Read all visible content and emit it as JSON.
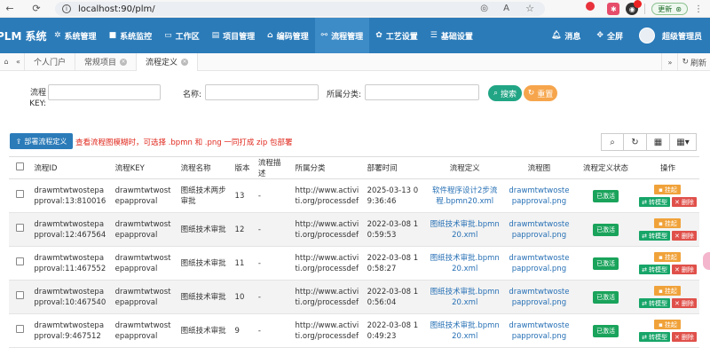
{
  "browser": {
    "url": "localhost:90/plm/",
    "update_label": "更新"
  },
  "app": {
    "brand": "PLM 系统",
    "menu": [
      {
        "label": "系统管理",
        "icon": "gear-icon"
      },
      {
        "label": "系统监控",
        "icon": "video-icon"
      },
      {
        "label": "工作区",
        "icon": "monitor-icon"
      },
      {
        "label": "项目管理",
        "icon": "book-icon"
      },
      {
        "label": "编码管理",
        "icon": "bank-icon"
      },
      {
        "label": "流程管理",
        "icon": "flow-icon",
        "active": true
      },
      {
        "label": "工艺设置",
        "icon": "paw-icon"
      },
      {
        "label": "基础设置",
        "icon": "list-icon"
      }
    ],
    "messages_label": "消息",
    "fullscreen_label": "全屏",
    "user_label": "超级管理员"
  },
  "tabs": {
    "items": [
      "个人门户",
      "常规项目",
      "流程定义"
    ],
    "refresh_label": "刷新"
  },
  "search": {
    "key_label": "流程KEY:",
    "name_label": "名称:",
    "category_label": "所属分类:",
    "search_button": "搜索",
    "reset_button": "重置"
  },
  "toolbar": {
    "deploy_button": "部署流程定义",
    "hint": "查看流程图模糊时，可选择 .bpmn 和 .png 一同打成 zip 包部署"
  },
  "table": {
    "headers": [
      "流程ID",
      "流程KEY",
      "流程名称",
      "版本",
      "流程描述",
      "所属分类",
      "部署时间",
      "流程定义",
      "流程图",
      "流程定义状态",
      "操作"
    ],
    "actions": {
      "hang": "挂起",
      "model": "转模型",
      "delete": "删除"
    },
    "rows": [
      {
        "id": "drawmtwtwostepapproval:13:810016",
        "key": "drawmtwtwostepapproval",
        "name": "图纸技术两步审批",
        "version": "13",
        "desc": "-",
        "category": "http://www.activiti.org/processdef",
        "time": "2025-03-13 09:36:46",
        "def": "软件程序设计2步流程.bpmn20.xml",
        "img": "drawmtwtwostepapproval.png",
        "status": "已激活"
      },
      {
        "id": "drawmtwtwostepapproval:12:467564",
        "key": "drawmtwtwostepapproval",
        "name": "图纸技术审批",
        "version": "12",
        "desc": "-",
        "category": "http://www.activiti.org/processdef",
        "time": "2022-03-08 10:59:53",
        "def": "图纸技术审批.bpmn20.xml",
        "img": "drawmtwtwostepapproval.png",
        "status": "已激活"
      },
      {
        "id": "drawmtwtwostepapproval:11:467552",
        "key": "drawmtwtwostepapproval",
        "name": "图纸技术审批",
        "version": "11",
        "desc": "-",
        "category": "http://www.activiti.org/processdef",
        "time": "2022-03-08 10:58:27",
        "def": "图纸技术审批.bpmn20.xml",
        "img": "drawmtwtwostepapproval.png",
        "status": "已激活"
      },
      {
        "id": "drawmtwtwostepapproval:10:467540",
        "key": "drawmtwtwostepapproval",
        "name": "图纸技术审批",
        "version": "10",
        "desc": "-",
        "category": "http://www.activiti.org/processdef",
        "time": "2022-03-08 10:56:04",
        "def": "图纸技术审批.bpmn20.xml",
        "img": "drawmtwtwostepapproval.png",
        "status": "已激活"
      },
      {
        "id": "drawmtwtwostepapproval:9:467512",
        "key": "drawmtwtwostepapproval",
        "name": "图纸技术审批",
        "version": "9",
        "desc": "-",
        "category": "http://www.activiti.org/processdef",
        "time": "2022-03-08 10:49:23",
        "def": "图纸技术审批.bpmn20.xml",
        "img": "drawmtwtwostepapproval.png",
        "status": "已激活"
      }
    ]
  }
}
